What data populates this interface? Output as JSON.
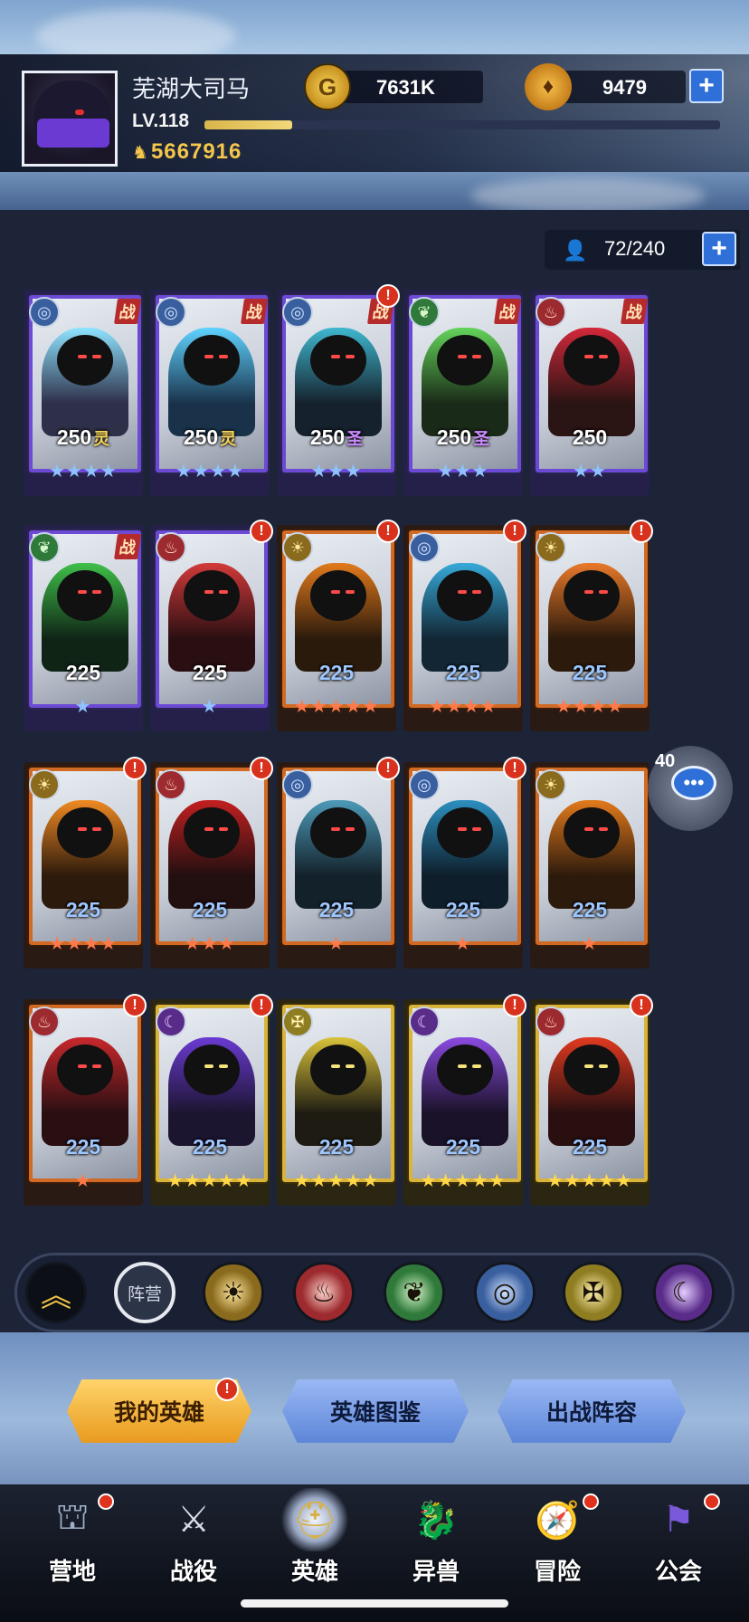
{
  "player": {
    "name": "芜湖大司马",
    "level": "LV.118",
    "xp_fraction": 0.17,
    "power": "5667916"
  },
  "resources": {
    "gold": "7631K",
    "gold_icon": "G",
    "gems": "9479"
  },
  "roster": {
    "count": "72/240"
  },
  "chat": {
    "count": "40"
  },
  "heroes": [
    {
      "level": "250",
      "spirit": "灵",
      "rank": "战",
      "stars": 4,
      "star_color": "blue",
      "frame": "purple",
      "faction": "water",
      "badge": false,
      "palette": [
        "#2e2f48",
        "#8fe4ff"
      ]
    },
    {
      "level": "250",
      "spirit": "灵",
      "rank": "战",
      "stars": 4,
      "star_color": "blue",
      "frame": "purple",
      "faction": "water",
      "badge": false,
      "palette": [
        "#19324a",
        "#5fd3ff"
      ]
    },
    {
      "level": "250",
      "spirit": "圣",
      "rank": "战",
      "stars": 3,
      "star_color": "blue",
      "frame": "purple",
      "faction": "water",
      "badge": true,
      "palette": [
        "#15212c",
        "#3fb7cf"
      ]
    },
    {
      "level": "250",
      "spirit": "圣",
      "rank": "战",
      "stars": 3,
      "star_color": "blue",
      "frame": "purple",
      "faction": "forest",
      "badge": false,
      "palette": [
        "#1a2a18",
        "#63d35a"
      ]
    },
    {
      "level": "250",
      "spirit": "",
      "rank": "战",
      "stars": 2,
      "star_color": "blue",
      "frame": "purple",
      "faction": "fire",
      "badge": false,
      "palette": [
        "#2a1414",
        "#d2283a"
      ]
    },
    {
      "level": "225",
      "spirit": "",
      "rank": "战",
      "stars": 1,
      "star_color": "blue",
      "frame": "purple",
      "faction": "forest",
      "badge": false,
      "palette": [
        "#102416",
        "#3fbf49"
      ]
    },
    {
      "level": "225",
      "spirit": "",
      "rank": "",
      "stars": 1,
      "star_color": "blue",
      "frame": "purple",
      "faction": "fire",
      "badge": true,
      "palette": [
        "#2a0f12",
        "#d23a3a"
      ]
    },
    {
      "level": "225",
      "spirit": "",
      "rank": "",
      "stars": 5,
      "star_color": "red",
      "frame": "orange",
      "faction": "light",
      "badge": true,
      "palette": [
        "#2a1a0c",
        "#e27a1c"
      ]
    },
    {
      "level": "225",
      "spirit": "",
      "rank": "",
      "stars": 4,
      "star_color": "red",
      "frame": "orange",
      "faction": "water",
      "badge": true,
      "palette": [
        "#122634",
        "#37a9d8"
      ]
    },
    {
      "level": "225",
      "spirit": "",
      "rank": "",
      "stars": 4,
      "star_color": "red",
      "frame": "orange",
      "faction": "light",
      "badge": true,
      "palette": [
        "#2c1a0c",
        "#e8792a"
      ]
    },
    {
      "level": "225",
      "spirit": "",
      "rank": "",
      "stars": 4,
      "star_color": "red",
      "frame": "orange",
      "faction": "light",
      "badge": true,
      "palette": [
        "#2c1a0c",
        "#ef8a22"
      ]
    },
    {
      "level": "225",
      "spirit": "",
      "rank": "",
      "stars": 3,
      "star_color": "red",
      "frame": "orange",
      "faction": "fire",
      "badge": true,
      "palette": [
        "#220f10",
        "#c22020"
      ]
    },
    {
      "level": "225",
      "spirit": "",
      "rank": "",
      "stars": 1,
      "star_color": "red",
      "frame": "orange",
      "faction": "water",
      "badge": true,
      "palette": [
        "#13212a",
        "#4c9ab8"
      ]
    },
    {
      "level": "225",
      "spirit": "",
      "rank": "",
      "stars": 1,
      "star_color": "red",
      "frame": "orange",
      "faction": "water",
      "badge": true,
      "palette": [
        "#0e1e2a",
        "#2c8fc0"
      ]
    },
    {
      "level": "225",
      "spirit": "",
      "rank": "",
      "stars": 1,
      "star_color": "red",
      "frame": "orange",
      "faction": "light",
      "badge": false,
      "palette": [
        "#2c1a0c",
        "#e27a1c"
      ]
    },
    {
      "level": "225",
      "spirit": "",
      "rank": "",
      "stars": 1,
      "star_color": "red",
      "frame": "orange",
      "faction": "fire",
      "badge": true,
      "palette": [
        "#2a0f12",
        "#c8282c"
      ]
    },
    {
      "level": "225",
      "spirit": "",
      "rank": "",
      "stars": 5,
      "star_color": "gold",
      "frame": "gold",
      "faction": "shadow",
      "badge": true,
      "palette": [
        "#1c1530",
        "#6a3ad2"
      ]
    },
    {
      "level": "225",
      "spirit": "",
      "rank": "",
      "stars": 5,
      "star_color": "gold",
      "frame": "gold",
      "faction": "holy",
      "badge": false,
      "palette": [
        "#1e1c12",
        "#d9c23a"
      ]
    },
    {
      "level": "225",
      "spirit": "",
      "rank": "",
      "stars": 5,
      "star_color": "gold",
      "frame": "gold",
      "faction": "shadow",
      "badge": true,
      "palette": [
        "#1a1228",
        "#8a4ae0"
      ]
    },
    {
      "level": "225",
      "spirit": "",
      "rank": "",
      "stars": 5,
      "star_color": "gold",
      "frame": "gold",
      "faction": "fire",
      "badge": true,
      "palette": [
        "#2a0f10",
        "#e03a20"
      ]
    }
  ],
  "faction_icons": {
    "water": {
      "glyph": "◎",
      "bg": "#3a5f9e",
      "fg": "#cfe2ff"
    },
    "forest": {
      "glyph": "❦",
      "bg": "#2f7a3b",
      "fg": "#d6f5c8"
    },
    "fire": {
      "glyph": "♨",
      "bg": "#9c2a2e",
      "fg": "#ffd3cc"
    },
    "light": {
      "glyph": "☀",
      "bg": "#8a6a1c",
      "fg": "#ffe7a0"
    },
    "shadow": {
      "glyph": "☾",
      "bg": "#5a2c8a",
      "fg": "#e3ccff"
    },
    "holy": {
      "glyph": "✠",
      "bg": "#8f7d22",
      "fg": "#fff1b0"
    }
  },
  "star_colors": {
    "blue": "#8fc3ff",
    "red": "#ff7a4a",
    "gold": "#ffd84a"
  },
  "filters": {
    "camp_label": "阵营",
    "items": [
      {
        "name": "light",
        "glyph": "☀",
        "bg": "#8a6a1c",
        "fg": "#ffe7a0"
      },
      {
        "name": "fire",
        "glyph": "♨",
        "bg": "#9c2a2e",
        "fg": "#ffd3cc"
      },
      {
        "name": "forest",
        "glyph": "❦",
        "bg": "#2f7a3b",
        "fg": "#d6f5c8"
      },
      {
        "name": "water",
        "glyph": "◎",
        "bg": "#3a5f9e",
        "fg": "#cfe2ff"
      },
      {
        "name": "holy",
        "glyph": "✠",
        "bg": "#8f7d22",
        "fg": "#fff1b0"
      },
      {
        "name": "shadow",
        "glyph": "☾",
        "bg": "#5a2c8a",
        "fg": "#e3ccff"
      }
    ]
  },
  "tabs": {
    "my_heroes": "我的英雄",
    "codex": "英雄图鉴",
    "lineup": "出战阵容",
    "badge": "!"
  },
  "nav": [
    {
      "label": "营地",
      "icon": "camp-icon",
      "glyph": "⛫",
      "color": "#9fb0c8",
      "dot": true,
      "active": false
    },
    {
      "label": "战役",
      "icon": "campaign-icon",
      "glyph": "⚔",
      "color": "#d6dce8",
      "dot": false,
      "active": false
    },
    {
      "label": "英雄",
      "icon": "hero-icon",
      "glyph": "⛑",
      "color": "#d7b24a",
      "dot": false,
      "active": true
    },
    {
      "label": "异兽",
      "icon": "beast-icon",
      "glyph": "🐉",
      "color": "#e0702a",
      "dot": false,
      "active": false
    },
    {
      "label": "冒险",
      "icon": "adventure-icon",
      "glyph": "🧭",
      "color": "#e0b24a",
      "dot": true,
      "active": false
    },
    {
      "label": "公会",
      "icon": "guild-icon",
      "glyph": "⚑",
      "color": "#7a5ad8",
      "dot": true,
      "active": false
    }
  ]
}
